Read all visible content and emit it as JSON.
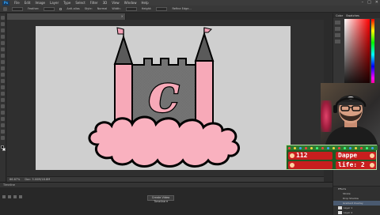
{
  "app": {
    "logo_text": "Ps",
    "menu": [
      "File",
      "Edit",
      "Image",
      "Layer",
      "Type",
      "Select",
      "Filter",
      "3D",
      "View",
      "Window",
      "Help"
    ],
    "window_controls": [
      "–",
      "□",
      "✕"
    ]
  },
  "options_bar": {
    "tool_preset": "Rectangular",
    "labels": [
      "Feather:",
      "Anti-alias",
      "Style:",
      "Normal",
      "Width:",
      "Height:",
      "Refine Edge..."
    ]
  },
  "document": {
    "tab_title": "dappernet-party.psd @ 66.7% (Rectangle 1 copy 2, RGB/8) *",
    "close_glyph": "×"
  },
  "status": {
    "zoom": "66.67%",
    "doc_info": "Doc: 3.00M/18.8M"
  },
  "timeline": {
    "header": "Timeline",
    "create_button": "Create Video Timeline ▾"
  },
  "right_panel": {
    "tabs": [
      "Color",
      "Swatches"
    ]
  },
  "layers": {
    "items": [
      {
        "name": "Effects",
        "sub": false
      },
      {
        "name": "Stroke",
        "sub": true
      },
      {
        "name": "Drop Shadow",
        "sub": true
      },
      {
        "name": "Gradient Overlay",
        "sub": true
      },
      {
        "name": "Layer 1",
        "sub": false
      },
      {
        "name": "Layer 2",
        "sub": false
      }
    ]
  },
  "game_overlay": {
    "score": "112",
    "name": "Dappe",
    "life_label": "life: 2"
  },
  "artwork": {
    "letter": "c",
    "colors": {
      "pink": "#f7a9b8",
      "tower_grey": "#777777",
      "flag": "#f4a0b6",
      "cloud": "#f9b1bf",
      "canvas": "#cfcfcf"
    }
  },
  "colors": {
    "accent": "#31a8ff",
    "overlay_red": "#c81e1e",
    "overlay_green": "#1d5a24"
  }
}
